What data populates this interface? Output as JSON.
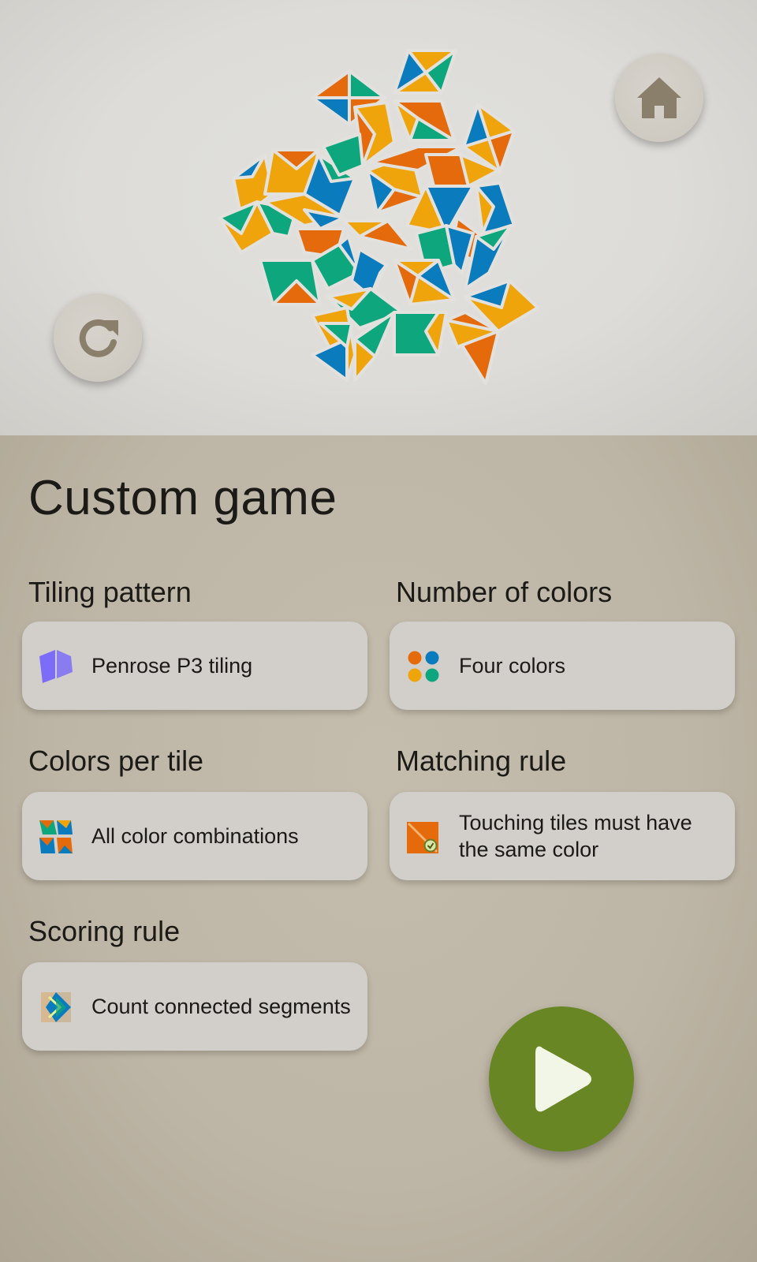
{
  "header": {
    "home_icon": "home-icon",
    "refresh_icon": "refresh-icon"
  },
  "title": "Custom game",
  "options": {
    "tiling_pattern": {
      "label": "Tiling pattern",
      "value": "Penrose P3 tiling",
      "icon": "rhombus-tiling-icon"
    },
    "number_of_colors": {
      "label": "Number of colors",
      "value": "Four colors",
      "icon": "four-dots-icon"
    },
    "colors_per_tile": {
      "label": "Colors per tile",
      "value": "All color combinations",
      "icon": "color-combinations-icon"
    },
    "matching_rule": {
      "label": "Matching rule",
      "value": "Touching tiles must have the same color",
      "icon": "matching-rule-icon"
    },
    "scoring_rule": {
      "label": "Scoring rule",
      "value": "Count connected segments",
      "icon": "connected-segments-icon"
    }
  },
  "play": {
    "icon": "play-icon"
  },
  "colors": {
    "orange": "#e46a0b",
    "blue": "#0a7bbd",
    "yellow": "#f0a40c",
    "green": "#0ea77d",
    "accent_green": "#688623",
    "penrose_icon": "#7c6cf7"
  }
}
